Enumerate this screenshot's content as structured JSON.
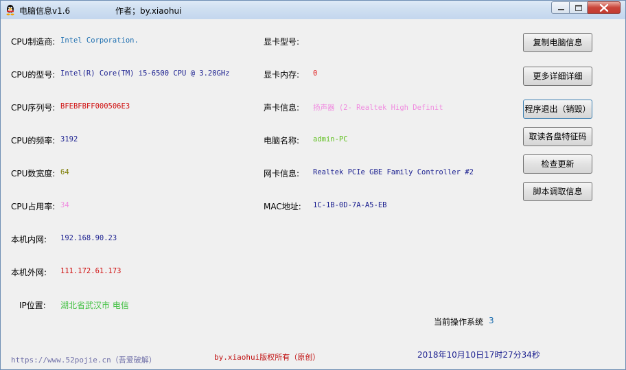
{
  "window": {
    "title": "电脑信息v1.6",
    "author": "作者；by.xiaohui"
  },
  "left": [
    {
      "label": "CPU制造商:",
      "value": "Intel Corporation.",
      "color": "#1e6fb0"
    },
    {
      "label": "CPU的型号:",
      "value": "Intel(R) Core(TM) i5-6500 CPU @ 3.20GHz",
      "color": "#1a1f8f"
    },
    {
      "label": "CPU序列号:",
      "value": "BFEBFBFF000506E3",
      "color": "#d01010"
    },
    {
      "label": "CPU的频率:",
      "value": "3192",
      "color": "#1a1f8f"
    },
    {
      "label": "CPU数宽度:",
      "value": "64",
      "color": "#7a7a00"
    },
    {
      "label": "CPU占用率:",
      "value": "34",
      "color": "#f08de0"
    },
    {
      "label": "本机内网:",
      "value": "192.168.90.23",
      "color": "#1a1f8f"
    },
    {
      "label": "本机外网:",
      "value": "111.172.61.173",
      "color": "#d01010"
    },
    {
      "label": "IP位置:",
      "value": "湖北省武汉市 电信",
      "color": "#40c040"
    }
  ],
  "right": [
    {
      "label": "显卡型号:",
      "value": "",
      "color": "#1a1f8f"
    },
    {
      "label": "显卡内存:",
      "value": "0",
      "color": "#e02020"
    },
    {
      "label": "声卡信息:",
      "value": "扬声器 (2- Realtek High Definit",
      "color": "#f08de0"
    },
    {
      "label": "电脑名称:",
      "value": "admin-PC",
      "color": "#60c020"
    },
    {
      "label": "网卡信息:",
      "value": "Realtek PCIe GBE Family Controller #2",
      "color": "#1a1f8f"
    },
    {
      "label": "MAC地址:",
      "value": "1C-1B-0D-7A-A5-EB",
      "color": "#1a1f8f"
    }
  ],
  "buttons": [
    "复制电脑信息",
    "更多详细详细",
    "程序退出（销毁）",
    "取读各盘特征码",
    "检查更新",
    "脚本调取信息"
  ],
  "os": {
    "label": "当前操作系统",
    "value": "3"
  },
  "footer": {
    "link": "https://www.52pojie.cn（吾爱破解）",
    "copyright": "by.xiaohui版权所有（原创）",
    "datetime": "2018年10月10日17时27分34秒"
  }
}
